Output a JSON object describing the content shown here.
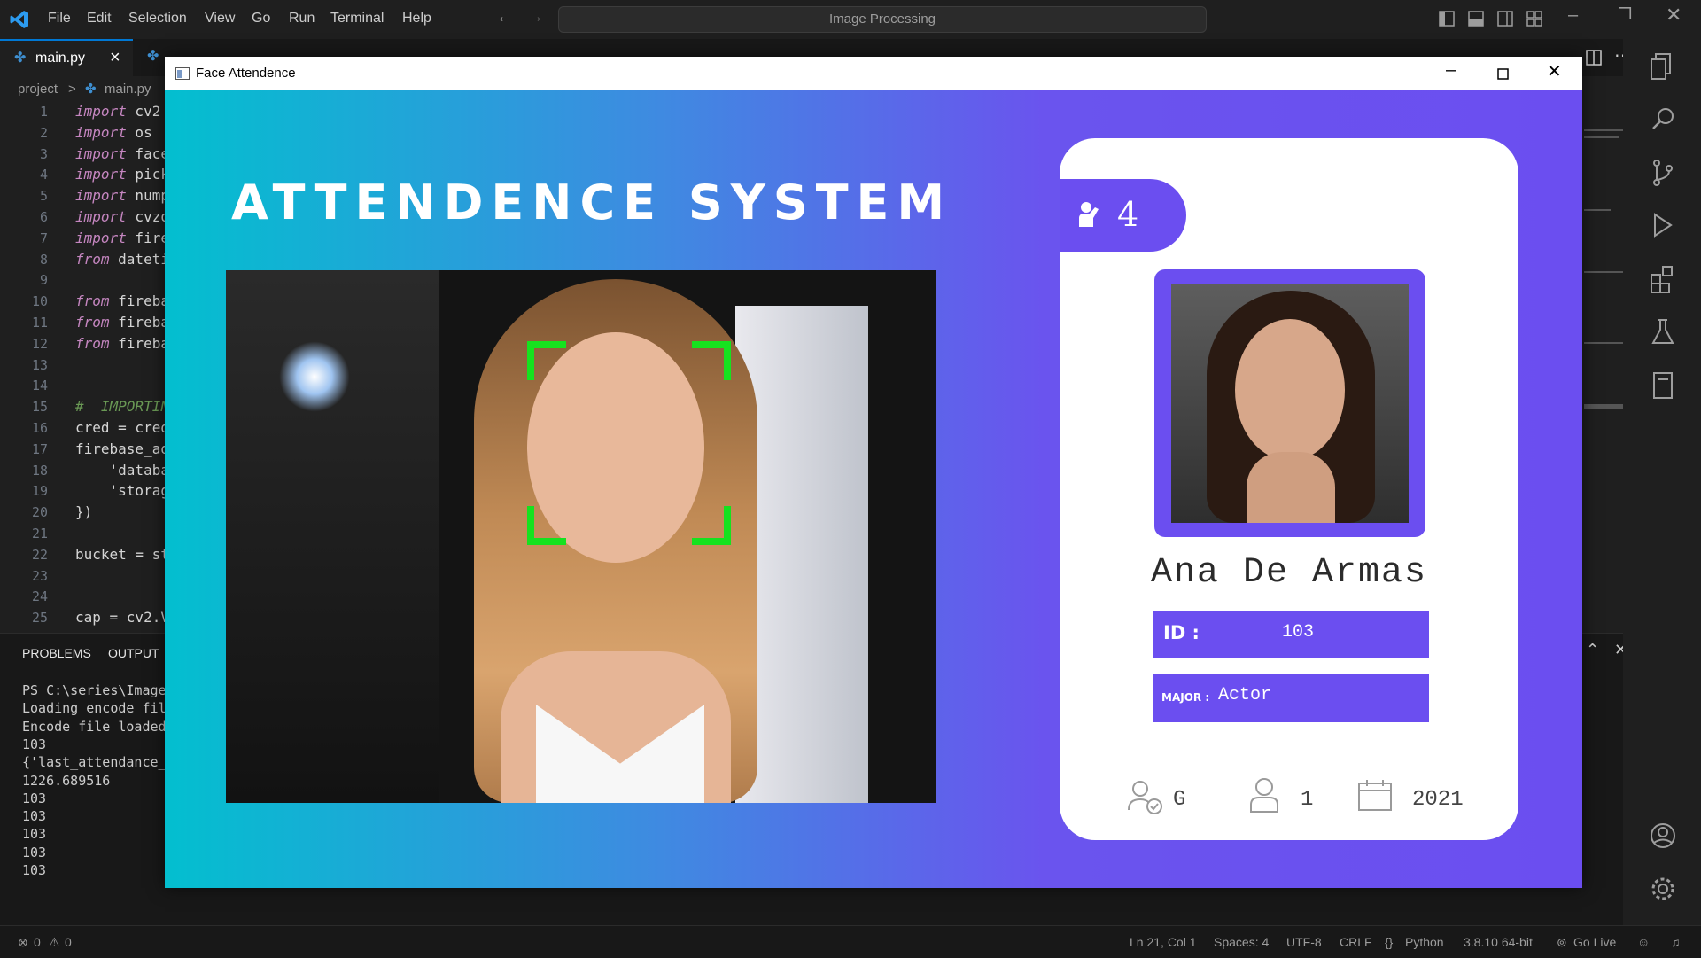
{
  "menu": [
    "File",
    "Edit",
    "Selection",
    "View",
    "Go",
    "Run",
    "Terminal",
    "Help"
  ],
  "search": {
    "label": "Image Processing"
  },
  "tabs": [
    {
      "label": "main.py",
      "close": "×"
    }
  ],
  "breadcrumb": {
    "folder": "project",
    "separator": ">",
    "file": "main.py"
  },
  "editor": {
    "lines": [
      {
        "n": "1",
        "kw": "import",
        "rest": " cv2"
      },
      {
        "n": "2",
        "kw": "import",
        "rest": " os"
      },
      {
        "n": "3",
        "kw": "import",
        "rest": " face"
      },
      {
        "n": "4",
        "kw": "import",
        "rest": " pick"
      },
      {
        "n": "5",
        "kw": "import",
        "rest": " nump"
      },
      {
        "n": "6",
        "kw": "import",
        "rest": " cvzo"
      },
      {
        "n": "7",
        "kw": "import",
        "rest": " fire"
      },
      {
        "n": "8",
        "kw": "from",
        "rest": " dateti"
      },
      {
        "n": "9",
        "kw": "",
        "rest": ""
      },
      {
        "n": "10",
        "kw": "from",
        "rest": " fireba"
      },
      {
        "n": "11",
        "kw": "from",
        "rest": " fireba"
      },
      {
        "n": "12",
        "kw": "from",
        "rest": " fireba"
      },
      {
        "n": "13",
        "kw": "",
        "rest": ""
      },
      {
        "n": "14",
        "kw": "",
        "rest": ""
      },
      {
        "n": "15",
        "kw": "",
        "rest": "#  IMPORTIN"
      },
      {
        "n": "16",
        "kw": "",
        "rest": "cred = cred"
      },
      {
        "n": "17",
        "kw": "",
        "rest": "firebase_ad"
      },
      {
        "n": "18",
        "kw": "",
        "rest": "    'databa"
      },
      {
        "n": "19",
        "kw": "",
        "rest": "    'storag"
      },
      {
        "n": "20",
        "kw": "",
        "rest": "})"
      },
      {
        "n": "21",
        "kw": "",
        "rest": ""
      },
      {
        "n": "22",
        "kw": "",
        "rest": "bucket = st"
      },
      {
        "n": "23",
        "kw": "",
        "rest": ""
      },
      {
        "n": "24",
        "kw": "",
        "rest": ""
      },
      {
        "n": "25",
        "kw": "",
        "rest": "cap = cv2.V"
      }
    ]
  },
  "panel": {
    "tabs": [
      "PROBLEMS",
      "OUTPUT"
    ],
    "terminal": [
      "PS C:\\series\\Image",
      "Loading encode fil",
      "Encode file loaded",
      "103",
      "{'last_attendance_",
      "1226.689516",
      "103",
      "103",
      "103",
      "103",
      "103"
    ]
  },
  "status": {
    "errors": "0",
    "warnings": "0",
    "position": "Ln 21, Col 1",
    "spaces": "Spaces: 4",
    "encoding": "UTF-8",
    "eol": "CRLF",
    "language": "Python",
    "interpreter": "3.8.10 64-bit",
    "golive": "Go Live"
  },
  "app": {
    "window_title": "Face Attendence",
    "heading": "ATTENDENCE SYSTEM",
    "card": {
      "total_attendance": "4",
      "name": "Ana De Armas",
      "id_label": "ID :",
      "id_value": "103",
      "major_label": "MAJOR :",
      "major_value": "Actor",
      "standing": "G",
      "year": "1",
      "starting_year": "2021"
    }
  },
  "colors": {
    "gradient_start": "#03bfcf",
    "gradient_end": "#6b4ef0",
    "card_accent": "#6b4ef0",
    "face_box": "#16e21f",
    "vscode_accent": "#0078d4"
  }
}
